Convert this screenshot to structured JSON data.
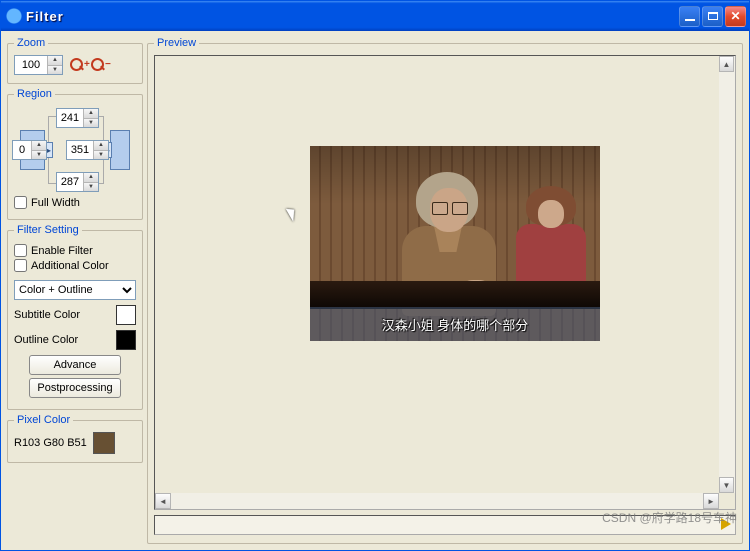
{
  "window": {
    "title": "Filter"
  },
  "zoom": {
    "legend": "Zoom",
    "value": "100"
  },
  "region": {
    "legend": "Region",
    "top": "241",
    "left": "0",
    "right": "351",
    "bottom": "287",
    "full_width_label": "Full Width",
    "full_width_checked": false
  },
  "filter_setting": {
    "legend": "Filter Setting",
    "enable_label": "Enable Filter",
    "enable_checked": false,
    "additional_label": "Additional Color",
    "additional_checked": false,
    "mode_selected": "Color + Outline",
    "subtitle_color_label": "Subtitle Color",
    "subtitle_color": "#ffffff",
    "outline_color_label": "Outline Color",
    "outline_color": "#000000",
    "advance_label": "Advance",
    "postprocessing_label": "Postprocessing"
  },
  "pixel_color": {
    "legend": "Pixel Color",
    "readout": "R103 G80 B51",
    "swatch": "#675033"
  },
  "preview": {
    "legend": "Preview",
    "subtitle_text": "汉森小姐  身体的哪个部分"
  },
  "watermark": "CSDN @府学路18号车神"
}
